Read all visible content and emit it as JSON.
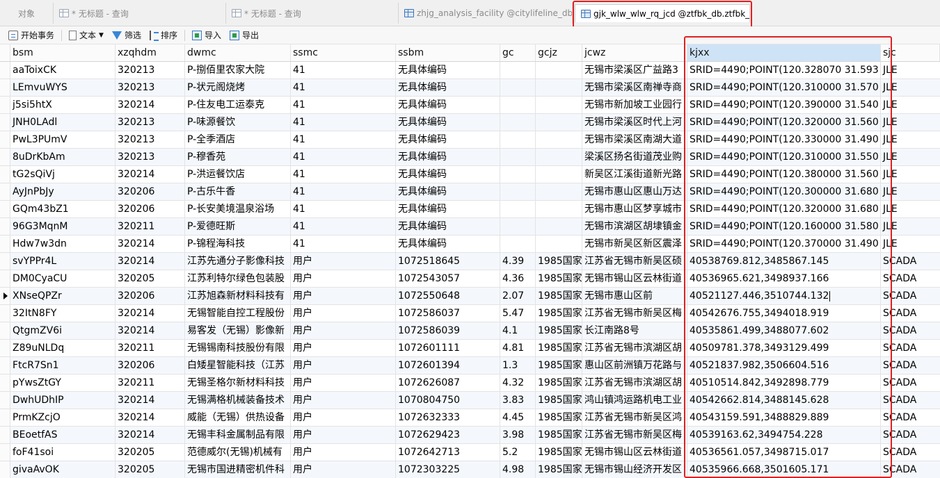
{
  "tabs": [
    {
      "label": "对象",
      "active": false
    },
    {
      "label": "* 无标题 - 查询",
      "active": false
    },
    {
      "label": "* 无标题 - 查询",
      "active": false
    },
    {
      "label": "zhjg_analysis_facility @citylifeline_db....",
      "active": false
    },
    {
      "label": "gjk_wlw_wlw_rq_jcd @ztfbk_db.ztfbk_...",
      "active": true
    }
  ],
  "toolbar": {
    "begin_tx": "开始事务",
    "text": "文本",
    "filter": "筛选",
    "sort": "排序",
    "import": "导入",
    "export": "导出"
  },
  "columns": [
    "bsm",
    "xzqhdm",
    "dwmc",
    "ssmc",
    "ssbm",
    "gc",
    "gcjz",
    "jcwz",
    "kjxx",
    "sjc"
  ],
  "selected_column": "kjxx",
  "current_row_index": 13,
  "rows": [
    [
      "aaToixCK",
      "320213",
      "P-捌佰里农家大院",
      "41",
      "无具体编码",
      "",
      "",
      "无锡市梁溪区广益路3",
      "SRID=4490;POINT(120.328070 31.593",
      "JLE"
    ],
    [
      "LEmvuWYS",
      "320213",
      "P-状元阁烧烤",
      "41",
      "无具体编码",
      "",
      "",
      "无锡市梁溪区南禅寺商",
      "SRID=4490;POINT(120.310000 31.570",
      "JLE"
    ],
    [
      "j5si5htX",
      "320214",
      "P-住友电工运泰克",
      "41",
      "无具体编码",
      "",
      "",
      "无锡市新加坡工业园行",
      "SRID=4490;POINT(120.390000 31.540",
      "JLE"
    ],
    [
      "JNH0LAdl",
      "320213",
      "P-味源餐饮",
      "41",
      "无具体编码",
      "",
      "",
      "无锡市梁溪区时代上河",
      "SRID=4490;POINT(120.320000 31.560",
      "JLE"
    ],
    [
      "PwL3PUmV",
      "320213",
      "P-全季酒店",
      "41",
      "无具体编码",
      "",
      "",
      "无锡市梁溪区南湖大道",
      "SRID=4490;POINT(120.330000 31.490",
      "JLE"
    ],
    [
      "8uDrKbAm",
      "320213",
      "P-穆香苑",
      "41",
      "无具体编码",
      "",
      "",
      "梁溪区扬名街道茂业购",
      "SRID=4490;POINT(120.310000 31.550",
      "JLE"
    ],
    [
      "tG2sQiVj",
      "320214",
      "P-洪运餐饮店",
      "41",
      "无具体编码",
      "",
      "",
      "新吴区江溪街道新光路",
      "SRID=4490;POINT(120.380000 31.560",
      "JLE"
    ],
    [
      "AyJnPbJy",
      "320206",
      "P-古乐牛香",
      "41",
      "无具体编码",
      "",
      "",
      "无锡市惠山区惠山万达",
      "SRID=4490;POINT(120.300000 31.680",
      "JLE"
    ],
    [
      "GQm43bZ1",
      "320206",
      "P-长安美境温泉浴场",
      "41",
      "无具体编码",
      "",
      "",
      "无锡市惠山区梦享城市",
      "SRID=4490;POINT(120.320000 31.680",
      "JLE"
    ],
    [
      "96G3MqnM",
      "320211",
      "P-爱德旺斯",
      "41",
      "无具体编码",
      "",
      "",
      "无锡市滨湖区胡埭镇金",
      "SRID=4490;POINT(120.160000 31.580",
      "JLE"
    ],
    [
      "Hdw7w3dn",
      "320214",
      "P-锦程海科技",
      "41",
      "无具体编码",
      "",
      "",
      "无锡市新吴区新区震泽",
      "SRID=4490;POINT(120.370000 31.490",
      "JLE"
    ],
    [
      "svYPPr4L",
      "320214",
      "江苏先通分子影像科技",
      "用户",
      "1072518645",
      "4.39",
      "1985国家",
      "江苏省无锡市新吴区硕",
      "40538769.812,3485867.145",
      "SCADA"
    ],
    [
      "DM0CyaCU",
      "320205",
      "江苏利特尔绿色包装股",
      "用户",
      "1072543057",
      "4.36",
      "1985国家",
      "无锡市锡山区云林街道",
      "40536965.621,3498937.166",
      "SCADA"
    ],
    [
      "XNseQPZr",
      "320206",
      "江苏旭森新材料科技有",
      "用户",
      "1072550648",
      "2.07",
      "1985国家",
      "无锡市惠山区前",
      "40521127.446,3510744.132",
      "SCADA"
    ],
    [
      "32ItN8FY",
      "320214",
      "无锡智能自控工程股份",
      "用户",
      "1072586037",
      "5.47",
      "1985国家",
      "江苏省无锡市新吴区梅",
      "40542676.755,3494018.919",
      "SCADA"
    ],
    [
      "QtgmZV6i",
      "320214",
      "易客发（无锡）影像新",
      "用户",
      "1072586039",
      "4.1",
      "1985国家",
      "长江南路8号",
      "40535861.499,3488077.602",
      "SCADA"
    ],
    [
      "Z89uNLDq",
      "320211",
      "无锡锡南科技股份有限",
      "用户",
      "1072601111",
      "4.81",
      "1985国家",
      "江苏省无锡市滨湖区胡",
      "40509781.378,3493129.499",
      "SCADA"
    ],
    [
      "FtcR7Sn1",
      "320206",
      "白矮星智能科技（江苏",
      "用户",
      "1072601394",
      "1.3",
      "1985国家",
      "惠山区前洲镇万花路与",
      "40521837.982,3506604.516",
      "SCADA"
    ],
    [
      "pYwsZtGY",
      "320211",
      "无锡圣格尔新材料科技",
      "用户",
      "1072626087",
      "4.32",
      "1985国家",
      "江苏省无锡市滨湖区胡",
      "40510514.842,3492898.779",
      "SCADA"
    ],
    [
      "DwhUDhIP",
      "320214",
      "无锡满格机械装备技术",
      "用户",
      "1070804750",
      "3.83",
      "1985国家",
      "鸿山镇鸿运路机电工业",
      "40542662.814,3488145.628",
      "SCADA"
    ],
    [
      "PrmKZcjO",
      "320214",
      "威能（无锡）供热设备",
      "用户",
      "1072632333",
      "4.45",
      "1985国家",
      "江苏省无锡市新吴区鸿",
      "40543159.591,3488829.889",
      "SCADA"
    ],
    [
      "BEoetfAS",
      "320214",
      "无锡丰科金属制品有限",
      "用户",
      "1072629423",
      "3.98",
      "1985国家",
      "江苏省无锡市新吴区梅",
      "40539163.62,3494754.228",
      "SCADA"
    ],
    [
      "foF41soi",
      "320205",
      "范德威尔(无锡)机械有",
      "用户",
      "1072642713",
      "5.2",
      "1985国家",
      "无锡市锡山区云林街道",
      "40536561.057,3498715.017",
      "SCADA"
    ],
    [
      "givaAvOK",
      "320205",
      "无锡市国进精密机件科",
      "用户",
      "1072303225",
      "4.98",
      "1985国家",
      "无锡市锡山经济开发区",
      "40535966.668,3501605.171",
      "SCADA"
    ]
  ]
}
